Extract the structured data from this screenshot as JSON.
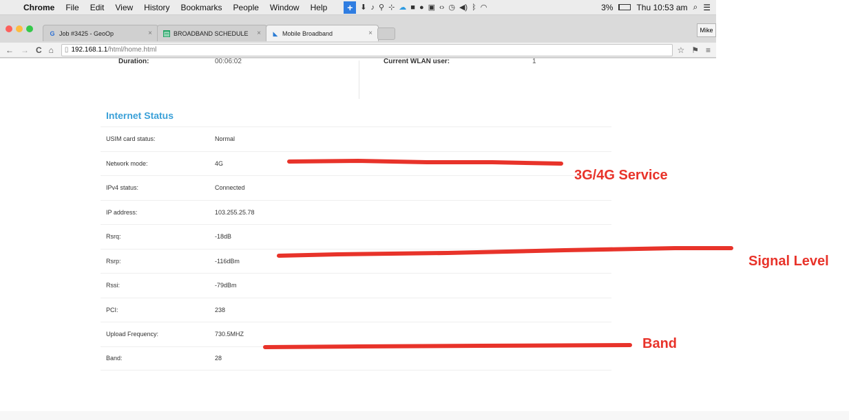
{
  "menubar": {
    "apple": "",
    "items": [
      "Chrome",
      "File",
      "Edit",
      "View",
      "History",
      "Bookmarks",
      "People",
      "Window",
      "Help"
    ],
    "battery_text": "3%",
    "battery_level": 0.03,
    "clock": "Thu 10:53 am",
    "search_icon": "magnifier-icon",
    "list_icon": "notification-list-icon"
  },
  "tabs": [
    {
      "title": "Job #3425 - GeoOp",
      "close": "×",
      "icon": "geoop-favicon",
      "active": false
    },
    {
      "title": "BROADBAND SCHEDULE",
      "close": "×",
      "icon": "sheets-favicon",
      "active": false
    },
    {
      "title": "Mobile Broadband",
      "close": "×",
      "icon": "router-favicon",
      "active": true
    }
  ],
  "profile": "Mike",
  "toolbar": {
    "back": "←",
    "forward": "→",
    "reload": "C",
    "home": "⌂",
    "url_host": "192.168.1.1",
    "url_path": "/html/home.html",
    "star": "☆",
    "menu": "≡"
  },
  "top": {
    "duration_label": "Duration:",
    "duration_value": "00:06:02",
    "wlan_label": "Current WLAN user:",
    "wlan_value": "1"
  },
  "internet_status": {
    "title": "Internet Status",
    "rows": [
      {
        "label": "USIM card status:",
        "value": "Normal"
      },
      {
        "label": "Network mode:",
        "value": "4G"
      },
      {
        "label": "IPv4 status:",
        "value": "Connected"
      },
      {
        "label": "IP address:",
        "value": "103.255.25.78"
      },
      {
        "label": "Rsrq:",
        "value": "-18dB"
      },
      {
        "label": "Rsrp:",
        "value": "-116dBm"
      },
      {
        "label": "Rssi:",
        "value": "-79dBm"
      },
      {
        "label": "PCI:",
        "value": "238"
      },
      {
        "label": "Upload Frequency:",
        "value": "730.5MHZ"
      },
      {
        "label": "Band:",
        "value": "28"
      }
    ]
  },
  "annotations": {
    "service": "3G/4G Service",
    "signal": "Signal Level",
    "band": "Band",
    "color": "#e8332a"
  }
}
